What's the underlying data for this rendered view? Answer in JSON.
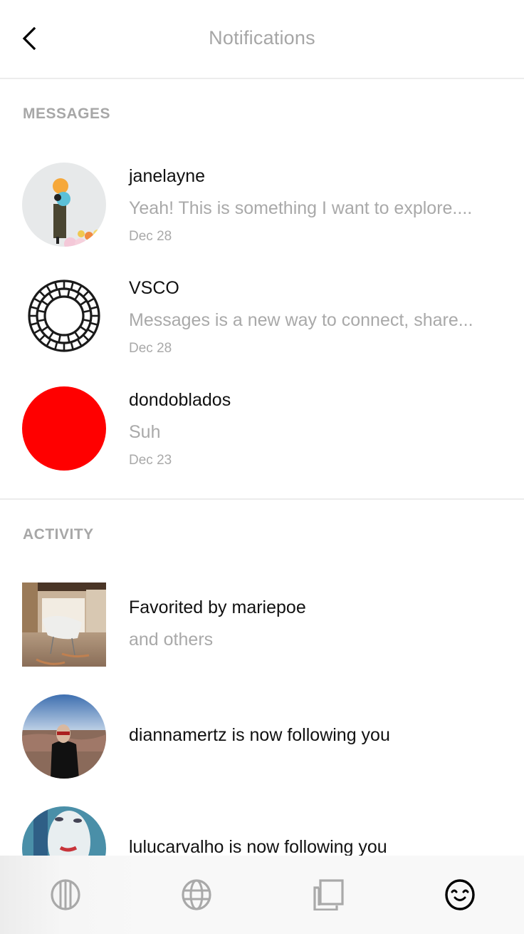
{
  "header": {
    "title": "Notifications",
    "back_icon": "chevron-left-icon"
  },
  "messages": {
    "section_title": "MESSAGES",
    "items": [
      {
        "name": "janelayne",
        "preview": "Yeah! This is something I want to explore....",
        "date": "Dec 28",
        "avatar": "photo-woman-balloons"
      },
      {
        "name": "VSCO",
        "preview": "Messages is a new way to connect, share...",
        "date": "Dec 28",
        "avatar": "vsco-logo"
      },
      {
        "name": "dondoblados",
        "preview": "Suh",
        "date": "Dec 23",
        "avatar": "red-circle",
        "avatar_color": "#ff0000"
      }
    ]
  },
  "activity": {
    "section_title": "ACTIVITY",
    "items": [
      {
        "text": "Favorited by mariepoe",
        "sub": "and others",
        "thumb": "photo-rocking-chair"
      },
      {
        "text": "diannamertz is now following you",
        "avatar": "photo-canyon-person"
      },
      {
        "text": "lulucarvalho is now following you",
        "avatar": "photo-woman-blue-hair"
      }
    ]
  },
  "tabbar": {
    "tabs": [
      {
        "name": "feed",
        "icon": "striped-circle-icon",
        "active": false
      },
      {
        "name": "discover",
        "icon": "globe-icon",
        "active": false
      },
      {
        "name": "collection",
        "icon": "stacked-squares-icon",
        "active": false
      },
      {
        "name": "notifications",
        "icon": "smiley-icon",
        "active": true
      }
    ],
    "active_color": "#000000",
    "inactive_color": "#a9a9a9"
  }
}
